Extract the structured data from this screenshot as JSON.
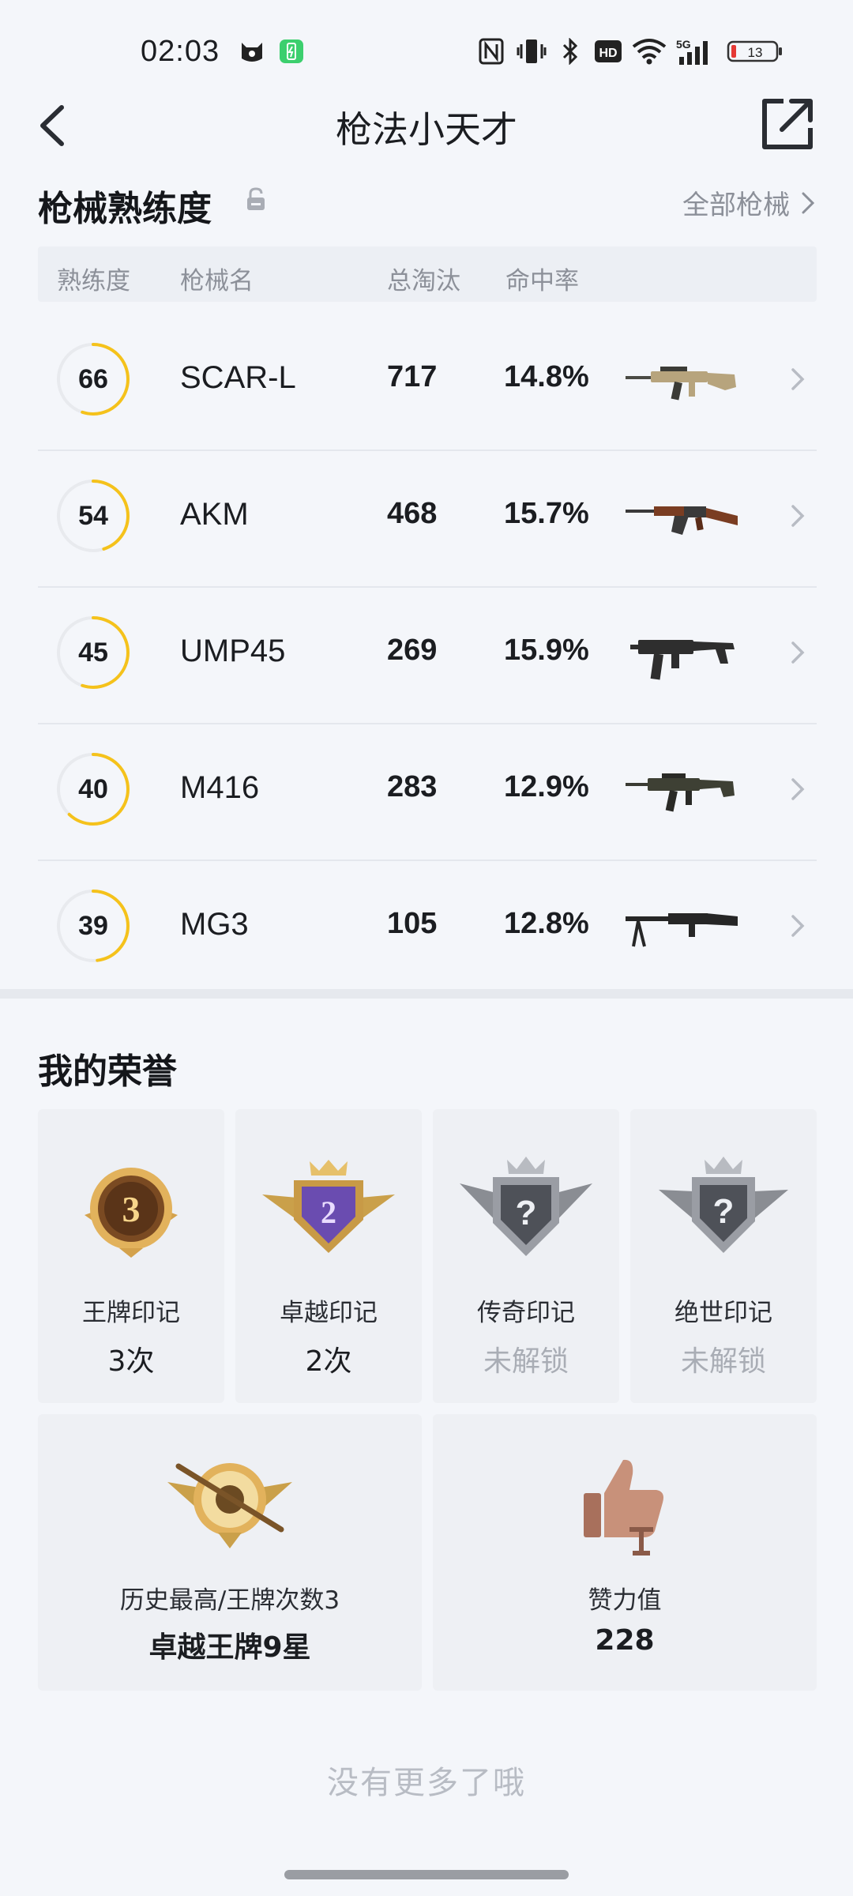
{
  "status_bar": {
    "time": "02:03",
    "battery": "13",
    "network": "5G"
  },
  "header": {
    "title": "枪法小天才"
  },
  "mastery": {
    "title": "枪械熟练度",
    "all_link": "全部枪械",
    "columns": [
      "熟练度",
      "枪械名",
      "总淘汰",
      "命中率"
    ],
    "rows": [
      {
        "level": "66",
        "progress": 0.55,
        "name": "SCAR-L",
        "kills": "717",
        "rate": "14.8%"
      },
      {
        "level": "54",
        "progress": 0.45,
        "name": "AKM",
        "kills": "468",
        "rate": "15.7%"
      },
      {
        "level": "45",
        "progress": 0.55,
        "name": "UMP45",
        "kills": "269",
        "rate": "15.9%"
      },
      {
        "level": "40",
        "progress": 0.62,
        "name": "M416",
        "kills": "283",
        "rate": "12.9%"
      },
      {
        "level": "39",
        "progress": 0.48,
        "name": "MG3",
        "kills": "105",
        "rate": "12.8%"
      }
    ]
  },
  "honors": {
    "title": "我的荣誉",
    "cards": [
      {
        "label": "王牌印记",
        "value": "3次",
        "badge_text": "3",
        "locked": false
      },
      {
        "label": "卓越印记",
        "value": "2次",
        "badge_text": "2",
        "locked": false
      },
      {
        "label": "传奇印记",
        "value": "未解锁",
        "badge_text": "?",
        "locked": true
      },
      {
        "label": "绝世印记",
        "value": "未解锁",
        "badge_text": "?",
        "locked": true
      }
    ],
    "wide_cards": [
      {
        "label": "历史最高/王牌次数3",
        "value": "卓越王牌9星"
      },
      {
        "label": "赞力值",
        "value": "228"
      }
    ]
  },
  "footer": {
    "no_more": "没有更多了哦"
  },
  "colors": {
    "accent": "#f5c21b",
    "ring_track": "#e8eaee",
    "background": "#f4f6fa"
  }
}
